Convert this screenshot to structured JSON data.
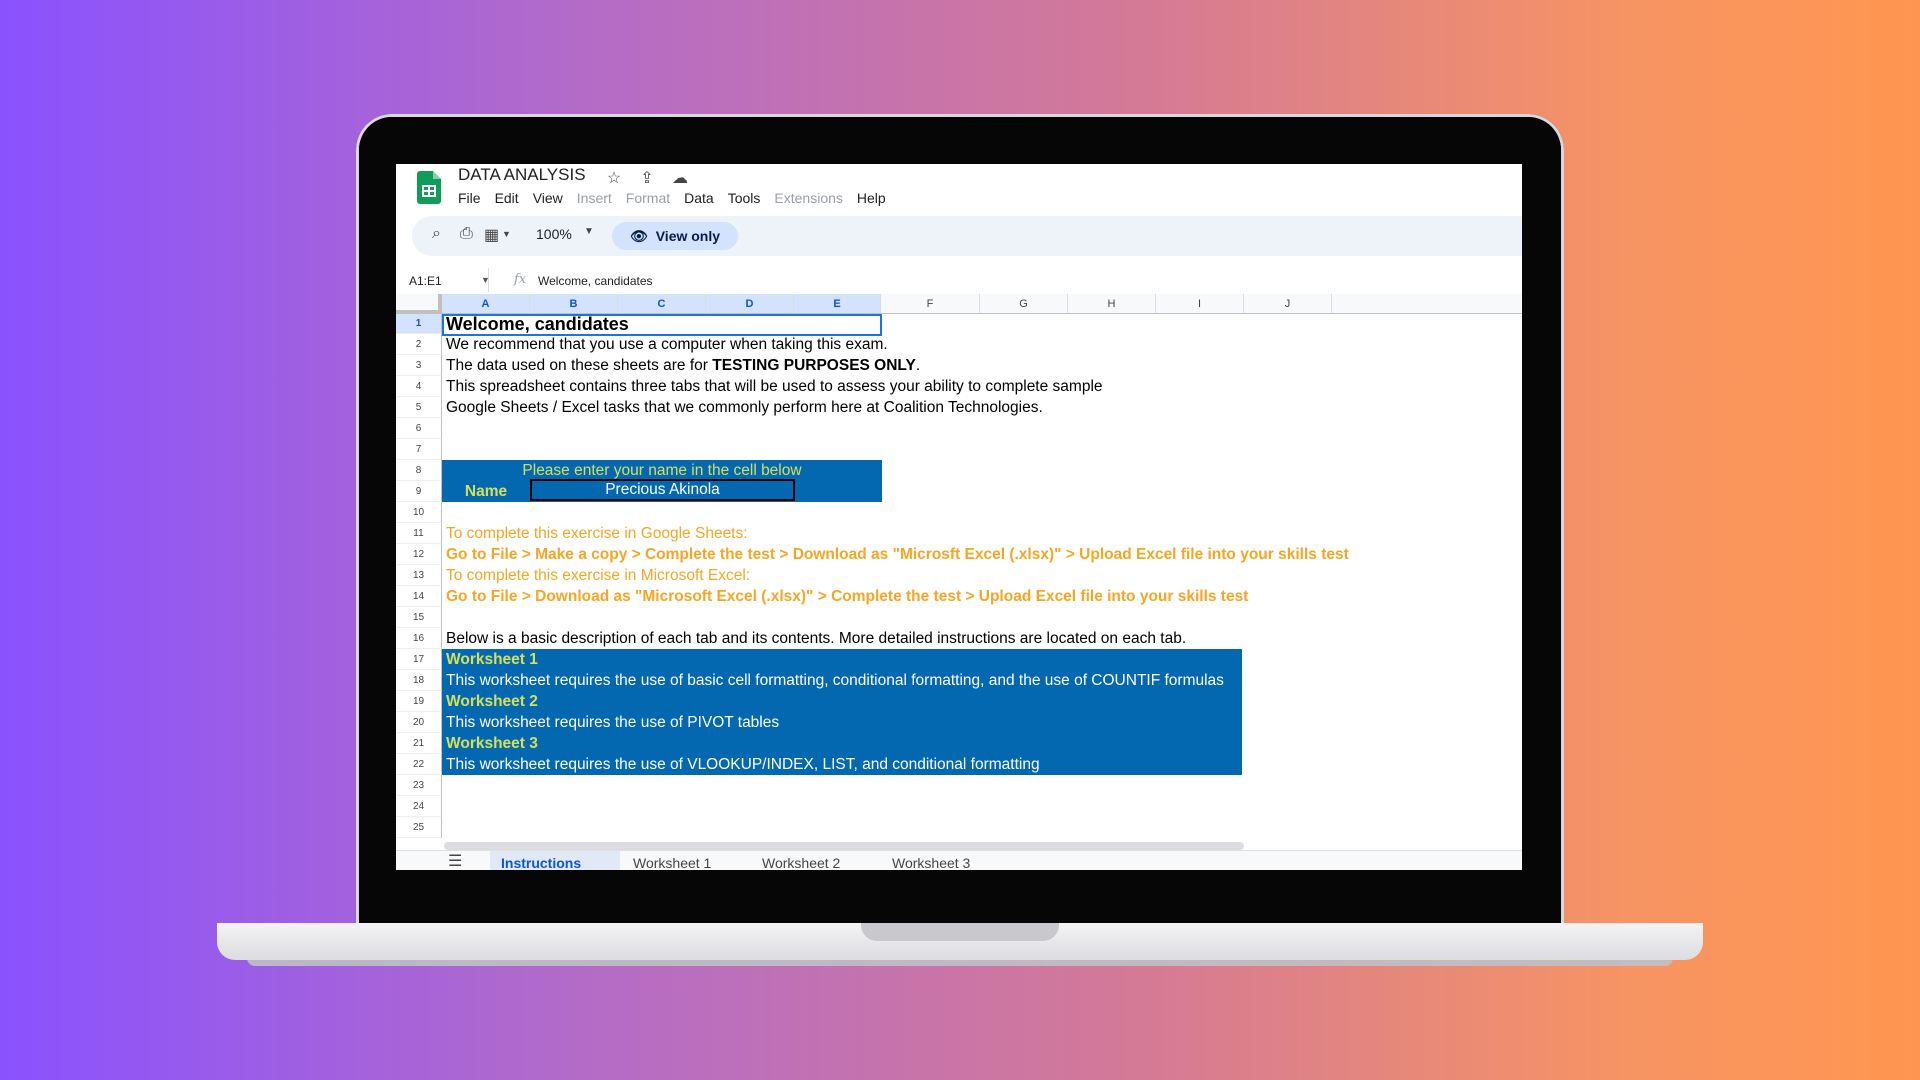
{
  "app": {
    "title": "DATA ANALYSIS",
    "menu": [
      "File",
      "Edit",
      "View",
      "Insert",
      "Format",
      "Data",
      "Tools",
      "Extensions",
      "Help"
    ],
    "menu_disabled": [
      "Insert",
      "Format",
      "Extensions"
    ]
  },
  "toolbar": {
    "zoom": "100%",
    "view_only_label": "View only"
  },
  "formula_bar": {
    "name_box": "A1:E1",
    "content": "Welcome, candidates"
  },
  "columns": [
    "A",
    "B",
    "C",
    "D",
    "E",
    "F",
    "G",
    "H",
    "I",
    "J"
  ],
  "rows": [
    "1",
    "2",
    "3",
    "4",
    "5",
    "6",
    "7",
    "8",
    "9",
    "10",
    "11",
    "12",
    "13",
    "14",
    "15",
    "16",
    "17",
    "18",
    "19",
    "20",
    "21",
    "22",
    "23",
    "24",
    "25"
  ],
  "cells": {
    "r1": "Welcome, candidates",
    "r2": "We recommend that you use a computer when taking this exam.",
    "r3_prefix": "The data used on these sheets are for ",
    "r3_bold": "TESTING PURPOSES ONLY",
    "r3_suffix": ".",
    "r4": "This spreadsheet contains three tabs that will be used to assess your ability to complete sample",
    "r5": "Google Sheets / Excel tasks that we commonly perform here at Coalition Technologies.",
    "r8": "Please enter your name in the cell below",
    "r9_label": "Name",
    "r9_value": "Precious Akinola",
    "r11": "To complete this exercise in Google Sheets:",
    "r12": "Go to File > Make a copy > Complete the test > Download as \"Microsft Excel (.xlsx)\" > Upload Excel file into your skills test",
    "r13": "To complete this exercise in Microsoft Excel:",
    "r14": "Go to File > Download as \"Microsoft Excel (.xlsx)\" > Complete the test > Upload Excel file into your skills test",
    "r16": "Below is a basic description of each tab and its contents. More detailed instructions are located on each tab.",
    "r17": "Worksheet 1",
    "r18": "This worksheet requires the use of basic cell formatting, conditional formatting, and the use of COUNTIF formulas",
    "r19": "Worksheet 2",
    "r20": "This worksheet requires the use of PIVOT tables",
    "r21": "Worksheet 3",
    "r22": "This worksheet requires the use of VLOOKUP/INDEX, LIST, and conditional formatting"
  },
  "sheet_tabs": [
    "Instructions",
    "Worksheet 1",
    "Worksheet 2",
    "Worksheet 3"
  ],
  "colors": {
    "block_blue": "#0468b1",
    "accent_yellow": "#d4e157",
    "orange": "#f6a623",
    "sheets_green": "#0f9d58"
  }
}
